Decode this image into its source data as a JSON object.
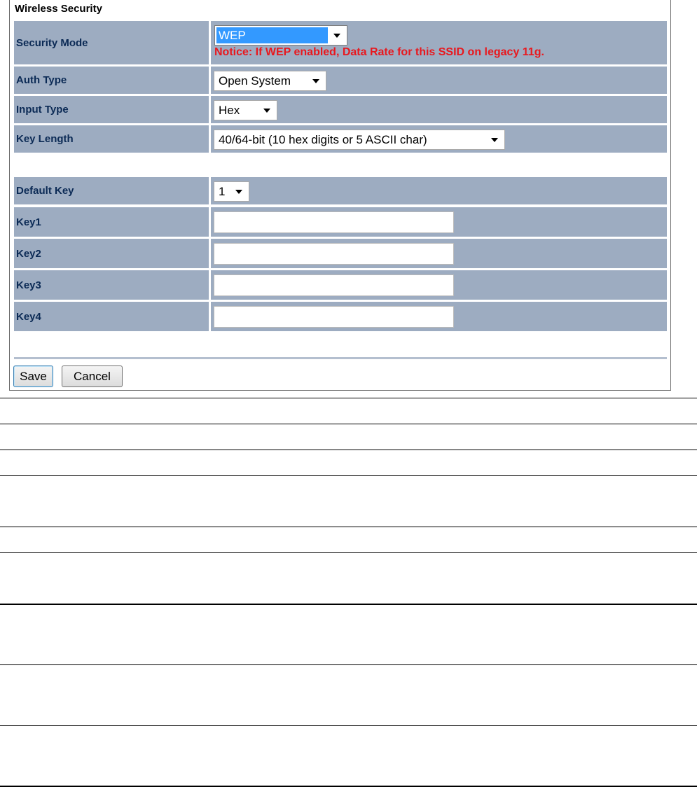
{
  "panel": {
    "title": "Wireless Security"
  },
  "fields": {
    "security_mode": {
      "label": "Security Mode",
      "value": "WEP",
      "notice": "Notice: If WEP enabled, Data Rate for this SSID on legacy 11g."
    },
    "auth_type": {
      "label": "Auth Type",
      "value": "Open System"
    },
    "input_type": {
      "label": "Input Type",
      "value": "Hex"
    },
    "key_length": {
      "label": "Key Length",
      "value": "40/64-bit (10 hex digits or 5 ASCII char)"
    },
    "default_key": {
      "label": "Default Key",
      "value": "1"
    },
    "key1": {
      "label": "Key1",
      "value": ""
    },
    "key2": {
      "label": "Key2",
      "value": ""
    },
    "key3": {
      "label": "Key3",
      "value": ""
    },
    "key4": {
      "label": "Key4",
      "value": ""
    }
  },
  "buttons": {
    "save": "Save",
    "cancel": "Cancel"
  },
  "icons": {
    "dropdown": "chevron-down-icon"
  },
  "colors": {
    "row_background": "#9dacc1",
    "label_text": "#0b2a55",
    "notice_text": "#e8181e",
    "selection_highlight": "#3399ff"
  }
}
